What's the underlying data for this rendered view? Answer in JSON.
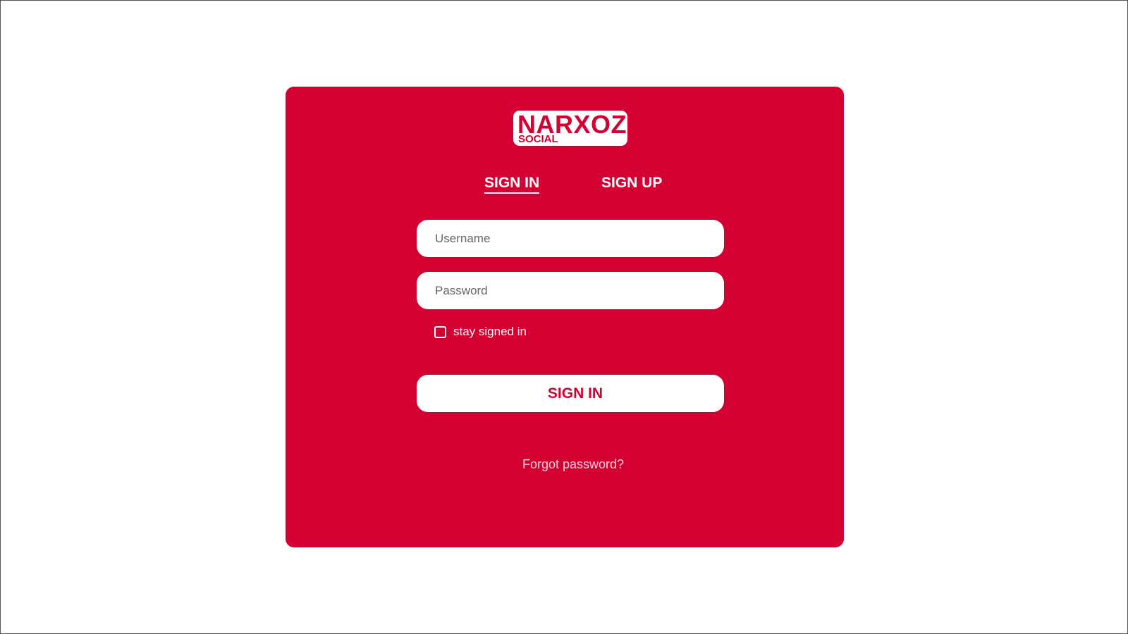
{
  "colors": {
    "brand": "#d30031",
    "background": "#ffffff",
    "surface": "#ffffff"
  },
  "logo": {
    "main": "NARXOZ",
    "sub": "SOCIAL"
  },
  "tabs": [
    {
      "label": "SIGN IN",
      "active": true
    },
    {
      "label": "SIGN UP",
      "active": false
    }
  ],
  "form": {
    "username_placeholder": "Username",
    "username_value": "",
    "password_placeholder": "Password",
    "password_value": "",
    "remember_label": "stay signed in",
    "remember_checked": false,
    "submit_label": "SIGN IN",
    "forgot_label": "Forgot password?"
  }
}
